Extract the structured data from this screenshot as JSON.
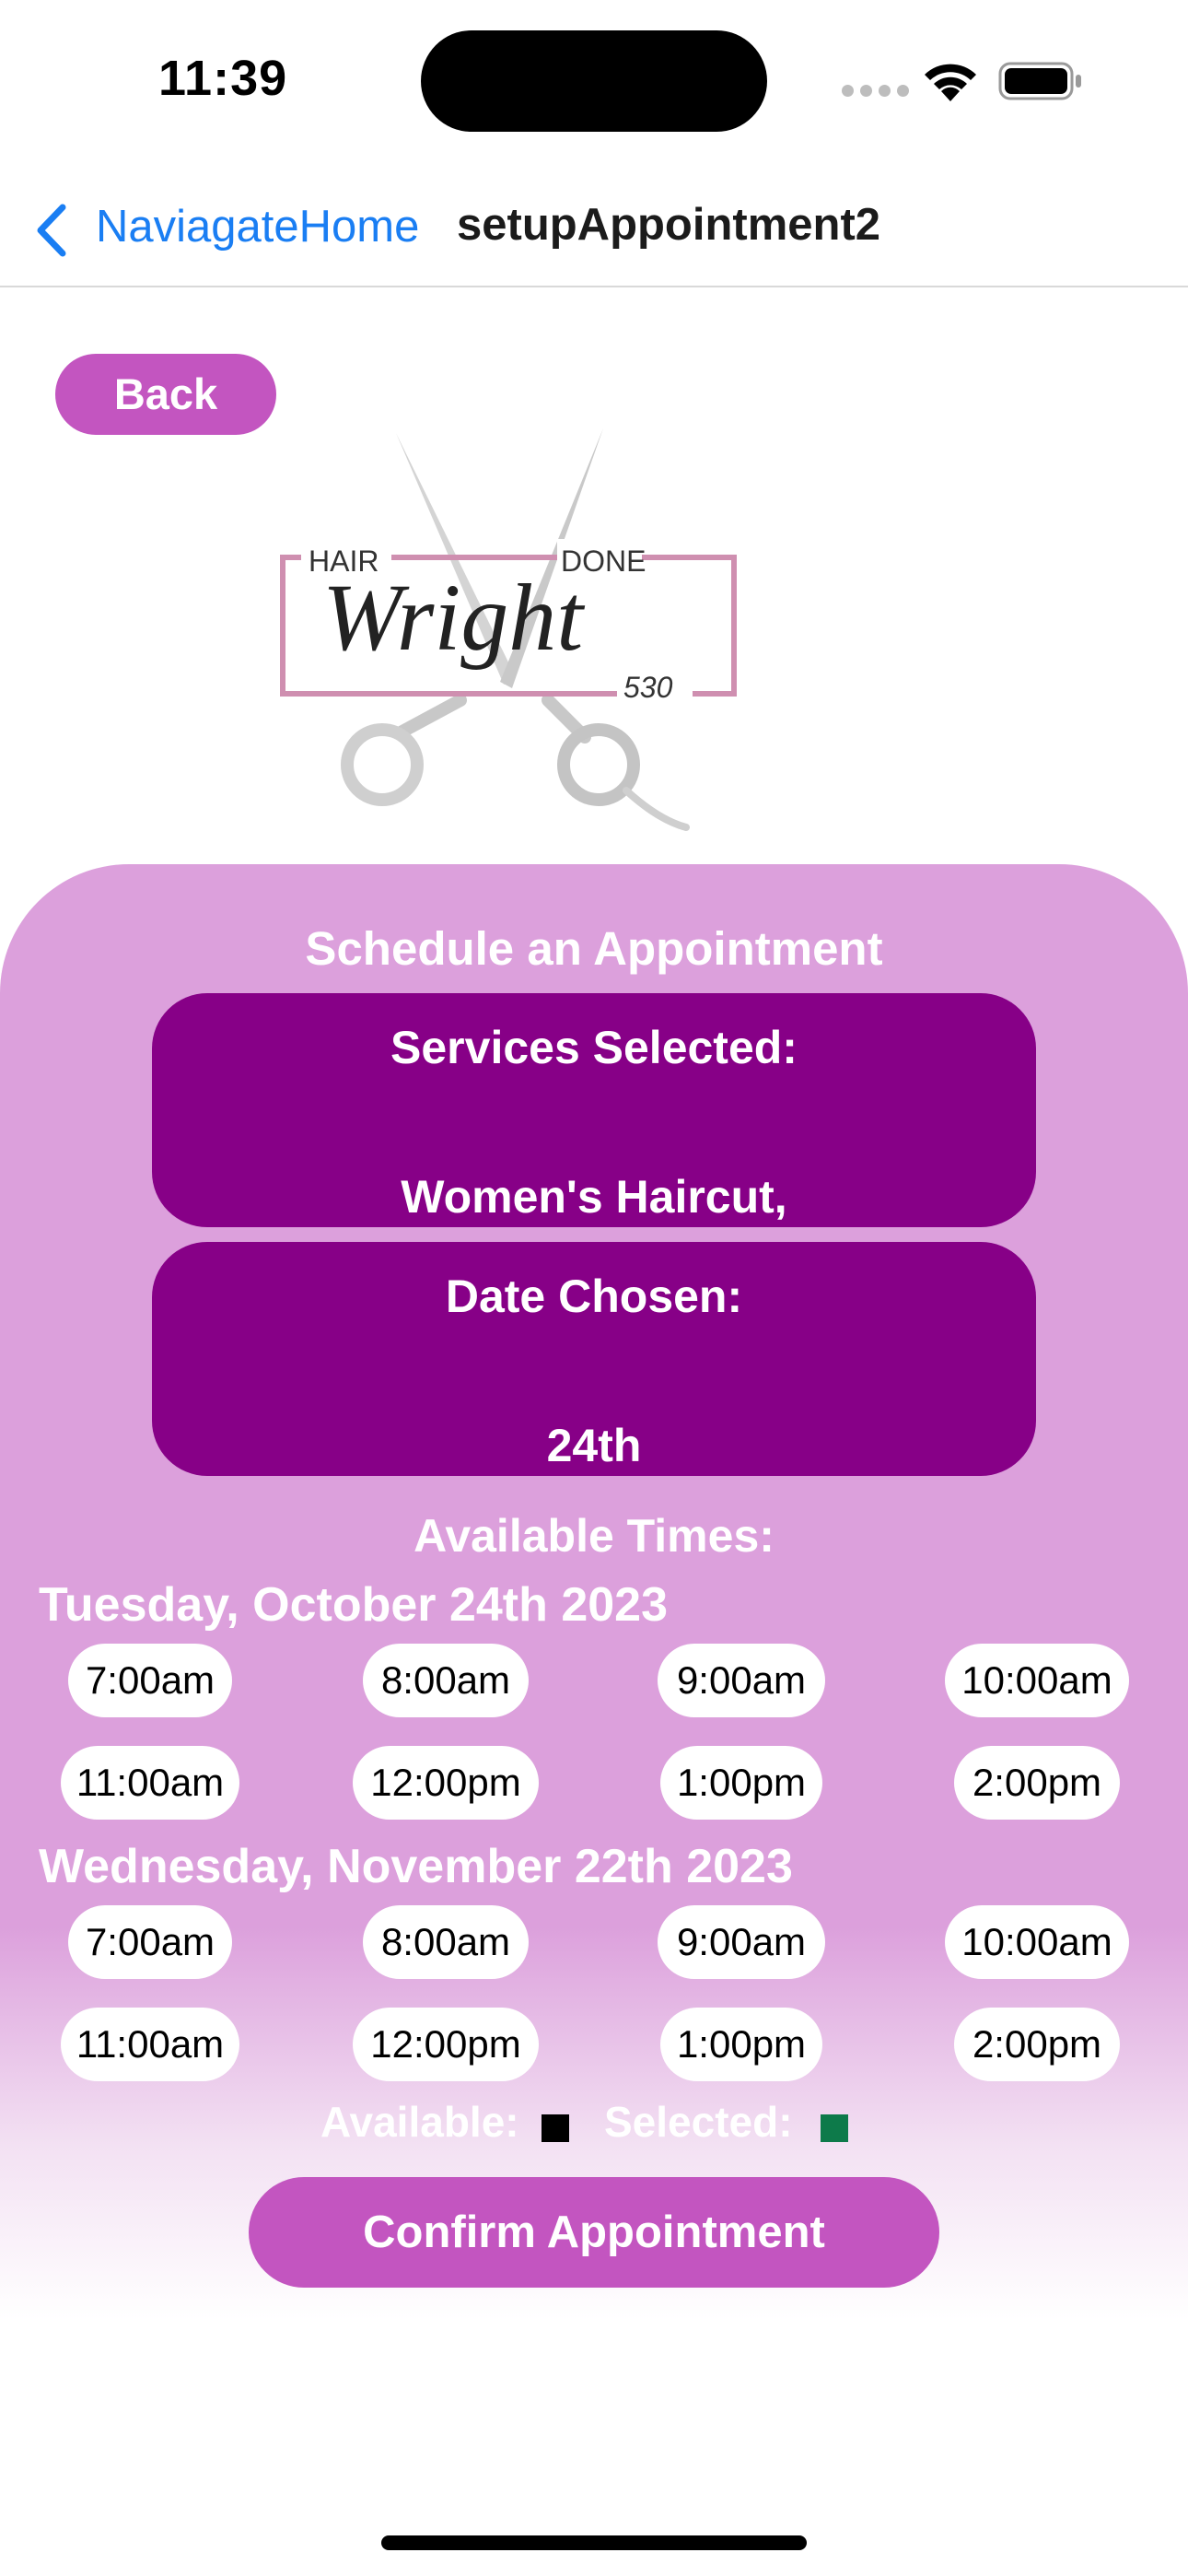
{
  "status_bar": {
    "time": "11:39"
  },
  "nav": {
    "back_label": "NaviagateHome",
    "title": "setupAppointment2"
  },
  "back_button": {
    "label": "Back"
  },
  "logo": {
    "word_left": "HAIR",
    "word_right": "DONE",
    "name": "Wright",
    "number": "530"
  },
  "schedule": {
    "title": "Schedule an Appointment",
    "services_label": "Services Selected:",
    "services_value": "Women's Haircut,",
    "date_label": "Date Chosen:",
    "date_value": "24th",
    "available_title": "Available Times:",
    "days": [
      {
        "heading": "Tuesday, October 24th 2023",
        "times": [
          "7:00am",
          "8:00am",
          "9:00am",
          "10:00am",
          "11:00am",
          "12:00pm",
          "1:00pm",
          "2:00pm"
        ]
      },
      {
        "heading": "Wednesday, November 22th 2023",
        "times": [
          "7:00am",
          "8:00am",
          "9:00am",
          "10:00am",
          "11:00am",
          "12:00pm",
          "1:00pm",
          "2:00pm"
        ]
      }
    ],
    "legend": {
      "available_label": "Available:",
      "selected_label": "Selected:",
      "available_color": "#000000",
      "selected_color": "#0d7a4a"
    },
    "confirm_label": "Confirm Appointment"
  },
  "colors": {
    "accent_button": "#c355c0",
    "info_box": "#870087",
    "panel": "#dca0dc",
    "nav_link": "#1a7ef3"
  }
}
